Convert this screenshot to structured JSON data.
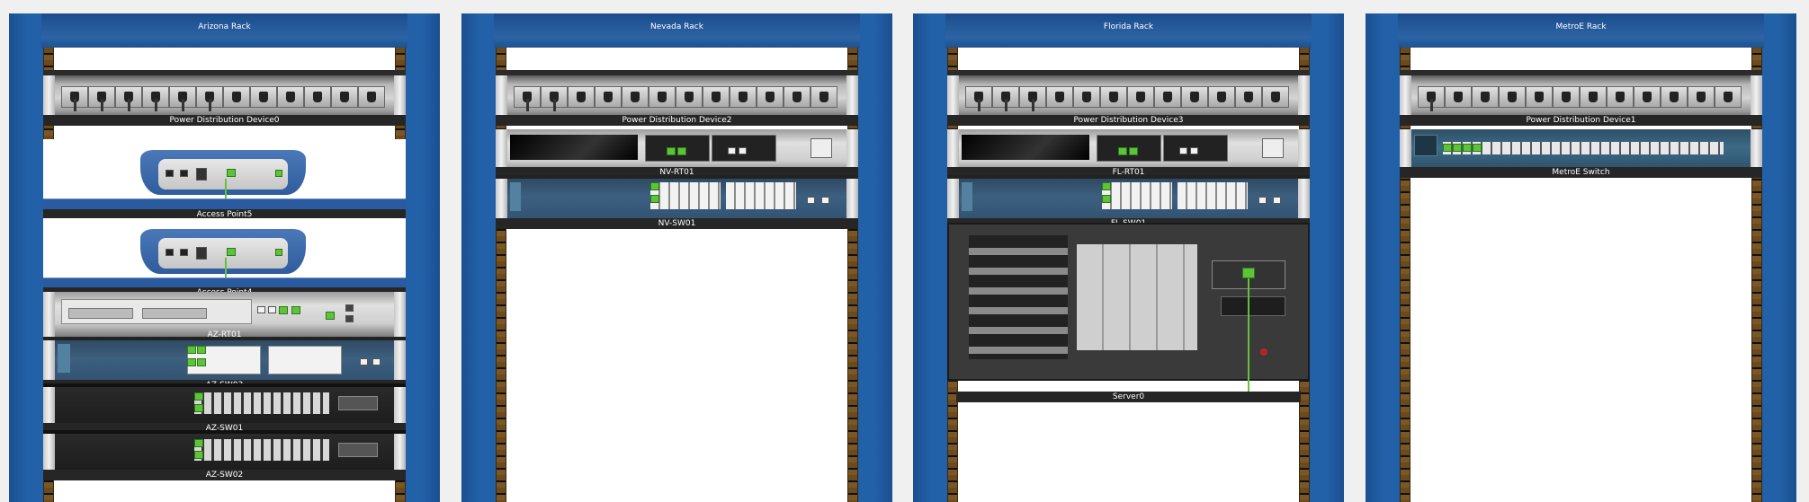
{
  "racks": [
    {
      "title": "Arizona Rack",
      "devices": {
        "pdu": "Power Distribution Device0",
        "ap5": "Access Point5",
        "ap4": "Access Point4",
        "rt01": "AZ-RT01",
        "sw03": "AZ-SW03",
        "sw01": "AZ-SW01",
        "sw02": "AZ-SW02"
      }
    },
    {
      "title": "Nevada Rack",
      "devices": {
        "pdu": "Power Distribution Device2",
        "rt01": "NV-RT01",
        "sw01": "NV-SW01"
      }
    },
    {
      "title": "Florida Rack",
      "devices": {
        "pdu": "Power Distribution Device3",
        "rt01": "FL-RT01",
        "sw01": "FL-SW01",
        "server": "Server0"
      }
    },
    {
      "title": "MetroE Rack",
      "devices": {
        "pdu": "Power Distribution Device1",
        "metro": "MetroE Switch"
      }
    }
  ],
  "colors": {
    "rack_frame": "#1e5ba3",
    "rail": "#6b4a1e",
    "link_green": "#64c23c",
    "label_bg": "#262626"
  }
}
